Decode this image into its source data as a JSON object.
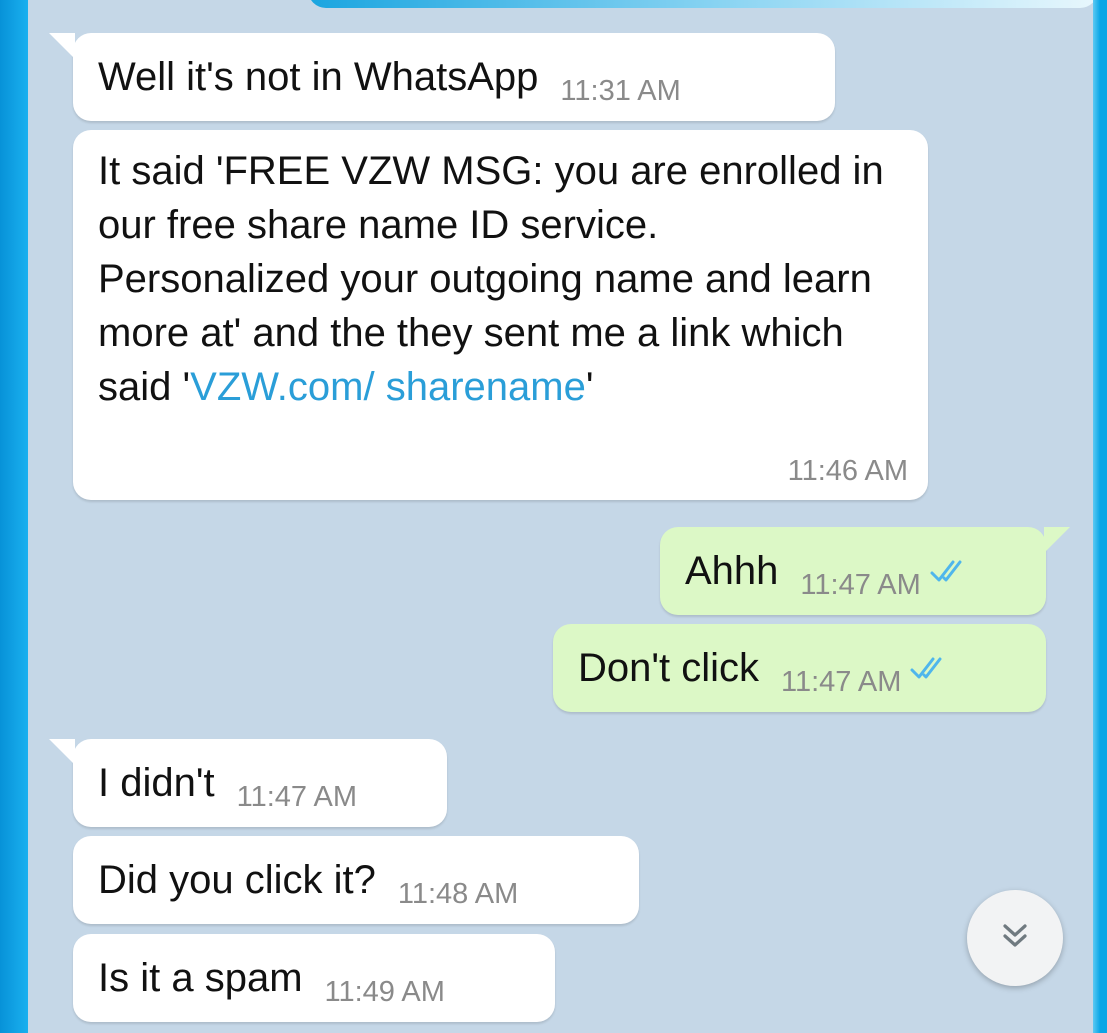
{
  "chat": {
    "messages": [
      {
        "direction": "in",
        "text": "Well it's not in WhatsApp",
        "time": "11:31 AM"
      },
      {
        "direction": "in",
        "text_before_link": "It said 'FREE VZW MSG: you are enrolled in our free share name ID service. Personalized your outgoing name and learn more at' and the they sent me a link which said '",
        "link": "VZW.com/ sharename",
        "text_after_link": "'",
        "time": "11:46 AM"
      },
      {
        "direction": "out",
        "text": "Ahhh",
        "time": "11:47 AM",
        "status": "read"
      },
      {
        "direction": "out",
        "text": "Don't click",
        "time": "11:47 AM",
        "status": "read"
      },
      {
        "direction": "in",
        "text": "I didn't",
        "time": "11:47 AM"
      },
      {
        "direction": "in",
        "text": "Did you click it?",
        "time": "11:48 AM"
      },
      {
        "direction": "in",
        "text": "Is it a spam",
        "time": "11:49 AM"
      }
    ]
  },
  "icons": {
    "read_receipt": "double-check-icon",
    "scroll_down": "double-chevron-down-icon"
  },
  "colors": {
    "background": "#c5d7e7",
    "incoming_bubble": "#ffffff",
    "outgoing_bubble": "#dcf8c6",
    "link": "#2a9ed8",
    "read_tick": "#4fb6ec",
    "timestamp": "#8a8a8a"
  }
}
